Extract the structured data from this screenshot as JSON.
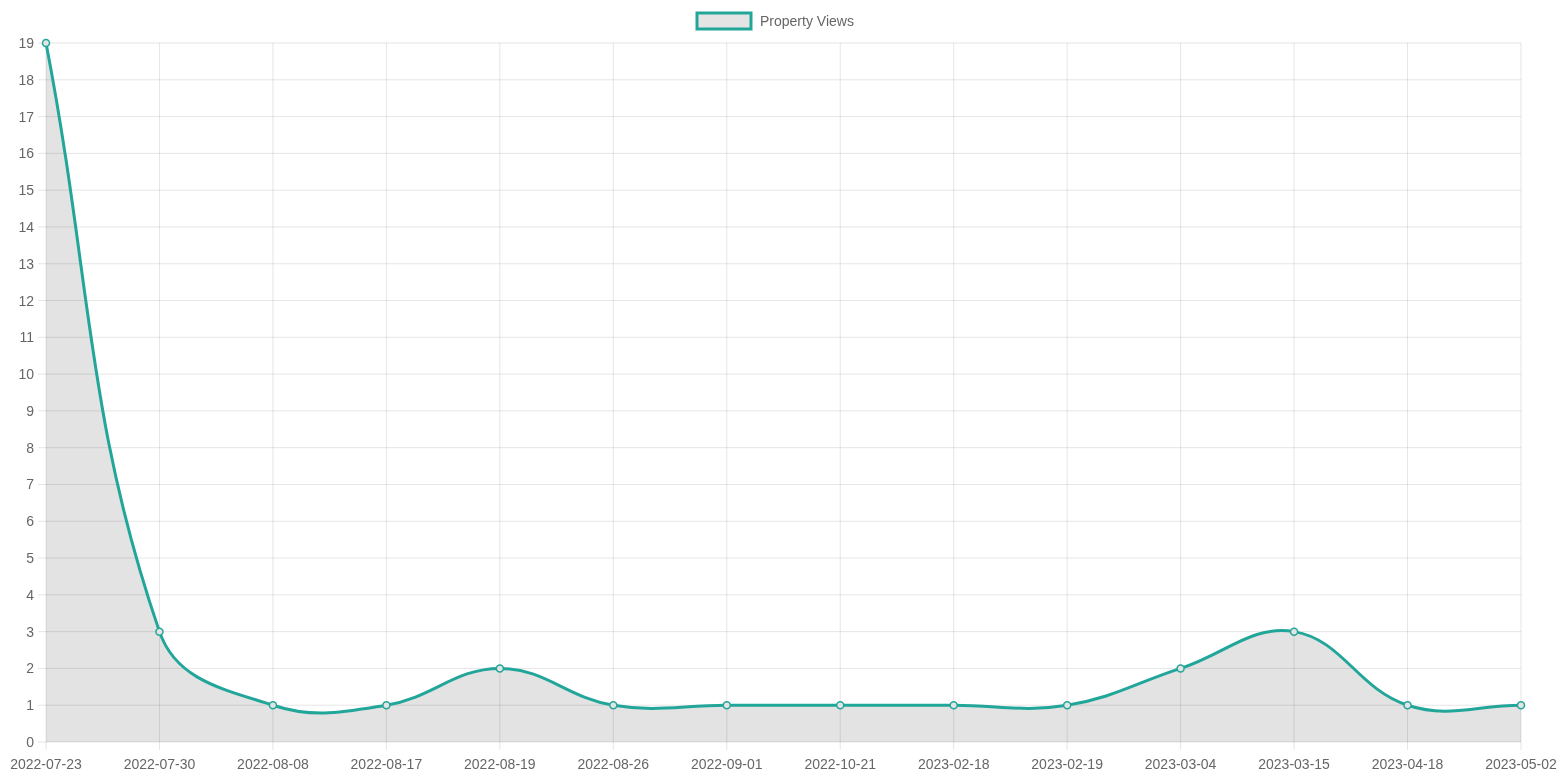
{
  "chart_data": {
    "type": "area",
    "categories": [
      "2022-07-23",
      "2022-07-30",
      "2022-08-08",
      "2022-08-17",
      "2022-08-19",
      "2022-08-26",
      "2022-09-01",
      "2022-10-21",
      "2023-02-18",
      "2023-02-19",
      "2023-03-04",
      "2023-03-15",
      "2023-04-18",
      "2023-05-02"
    ],
    "series": [
      {
        "name": "Property Views",
        "color": "#22a699",
        "values": [
          19,
          3,
          1,
          1,
          2,
          1,
          1,
          1,
          1,
          1,
          2,
          3,
          1,
          1
        ]
      }
    ],
    "grid": true,
    "ylim": [
      0,
      19
    ],
    "yticks": [
      0,
      1,
      2,
      3,
      4,
      5,
      6,
      7,
      8,
      9,
      10,
      11,
      12,
      13,
      14,
      15,
      16,
      17,
      18,
      19
    ]
  }
}
